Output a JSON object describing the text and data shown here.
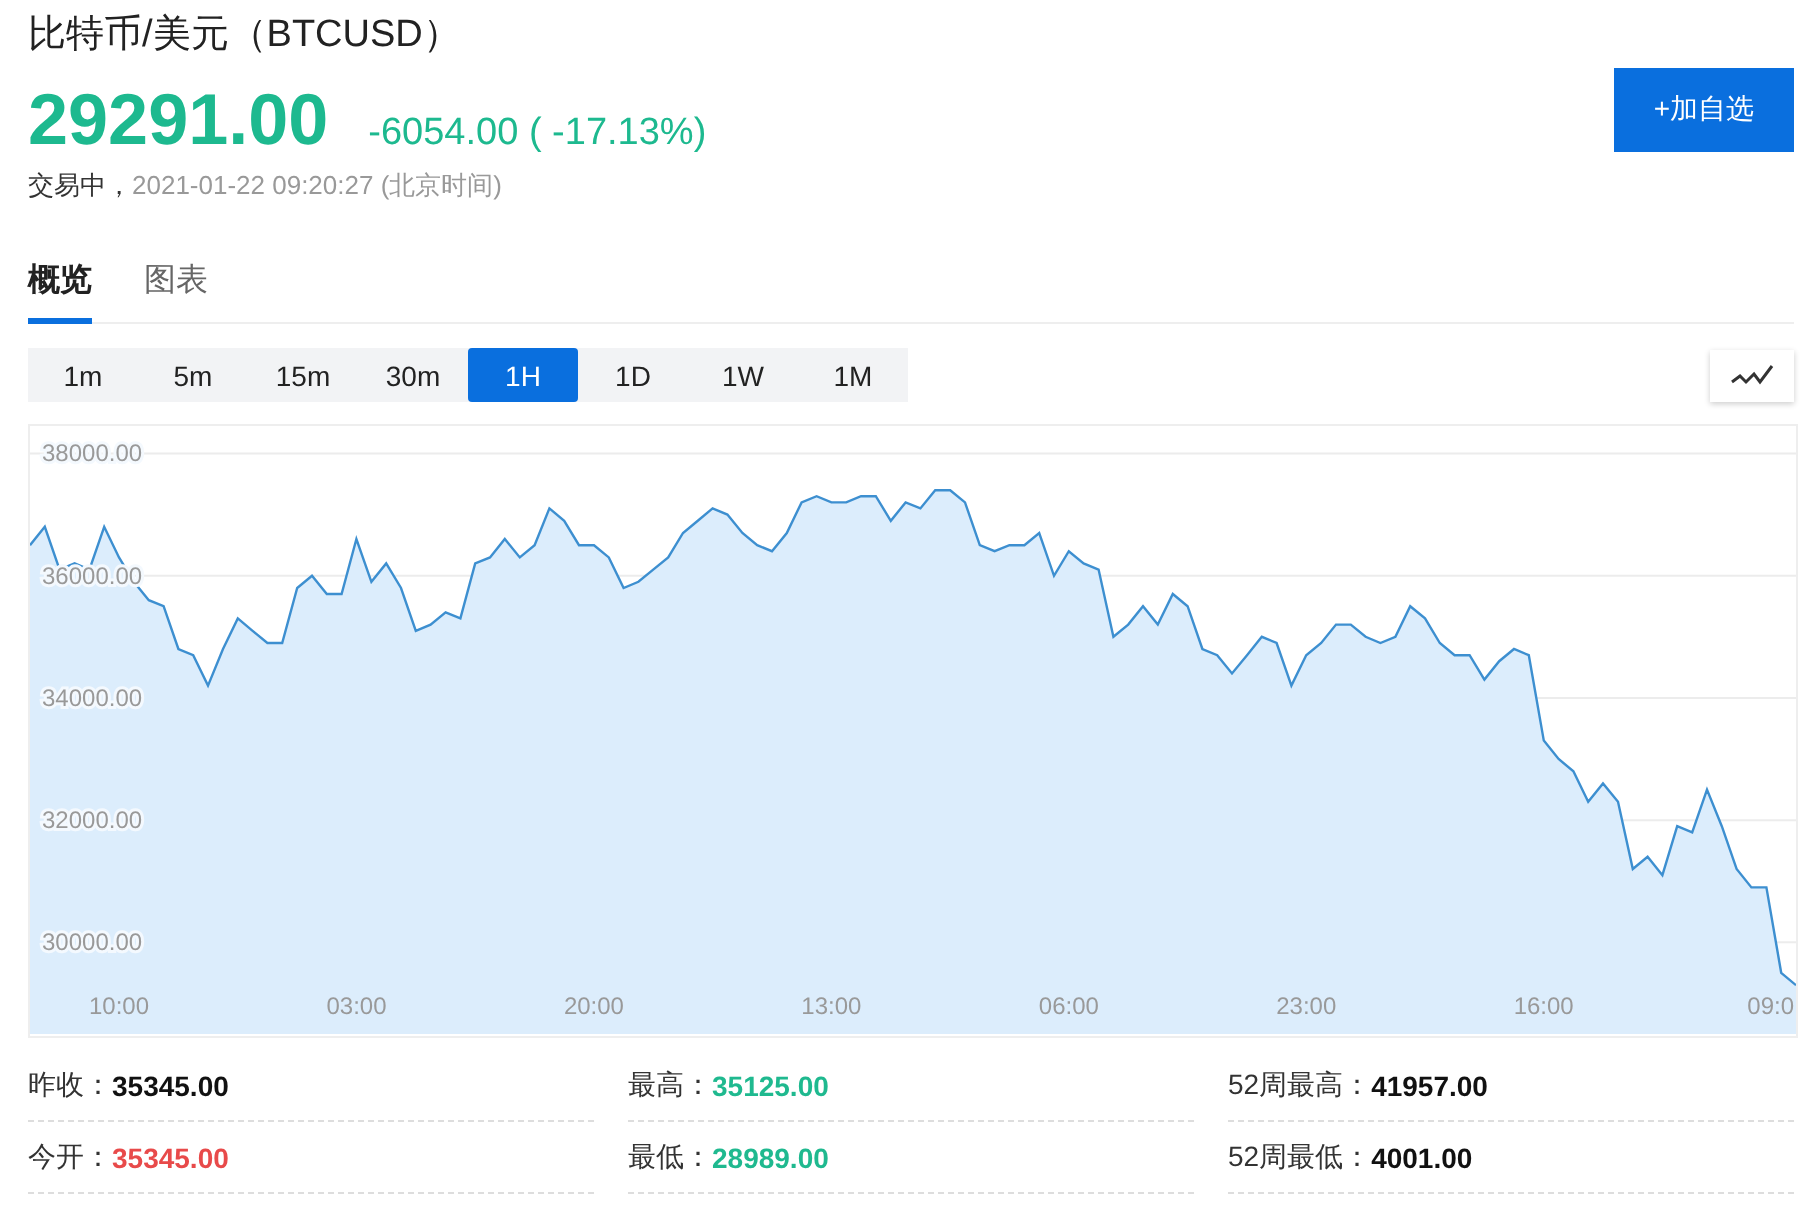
{
  "header": {
    "title": "比特币/美元（BTCUSD）",
    "price": "29291.00",
    "change": "-6054.00 ( -17.13%)",
    "status": "交易中，",
    "timestamp": "2021-01-22 09:20:27 (北京时间)",
    "watch_button": "+加自选"
  },
  "tabs": [
    {
      "label": "概览",
      "selected": true
    },
    {
      "label": "图表",
      "selected": false
    }
  ],
  "periods": [
    {
      "label": "1m",
      "selected": false
    },
    {
      "label": "5m",
      "selected": false
    },
    {
      "label": "15m",
      "selected": false
    },
    {
      "label": "30m",
      "selected": false
    },
    {
      "label": "1H",
      "selected": true
    },
    {
      "label": "1D",
      "selected": false
    },
    {
      "label": "1W",
      "selected": false
    },
    {
      "label": "1M",
      "selected": false
    }
  ],
  "chart": {
    "chart_data": {
      "type": "area",
      "grid": true,
      "ylim": [
        28500,
        38450
      ],
      "categories": [
        null,
        null,
        null,
        null,
        null,
        null,
        "10:00",
        null,
        null,
        null,
        null,
        null,
        null,
        null,
        null,
        null,
        null,
        null,
        null,
        null,
        null,
        null,
        "03:00",
        null,
        null,
        null,
        null,
        null,
        null,
        null,
        null,
        null,
        null,
        null,
        null,
        null,
        null,
        null,
        "20:00",
        null,
        null,
        null,
        null,
        null,
        null,
        null,
        null,
        null,
        null,
        null,
        null,
        null,
        null,
        null,
        "13:00",
        null,
        null,
        null,
        null,
        null,
        null,
        null,
        null,
        null,
        null,
        null,
        null,
        null,
        null,
        null,
        "06:00",
        null,
        null,
        null,
        null,
        null,
        null,
        null,
        null,
        null,
        null,
        null,
        null,
        null,
        null,
        null,
        "23:00",
        null,
        null,
        null,
        null,
        null,
        null,
        null,
        null,
        null,
        null,
        null,
        null,
        null,
        null,
        null,
        "16:00",
        null,
        null,
        null,
        null,
        null,
        null,
        null,
        null,
        null,
        null,
        null,
        null,
        null,
        null,
        "09:0",
        null,
        null
      ],
      "yticks": [
        {
          "value": 38000,
          "label": "38000.00"
        },
        {
          "value": 36000,
          "label": "36000.00"
        },
        {
          "value": 34000,
          "label": "34000.00"
        },
        {
          "value": 32000,
          "label": "32000.00"
        },
        {
          "value": 30000,
          "label": "30000.00"
        }
      ],
      "series": [
        {
          "color": "#3d8fd0",
          "values": [
            36500,
            36800,
            36100,
            36200,
            36100,
            36800,
            36300,
            35900,
            35600,
            35500,
            34800,
            34700,
            34200,
            34800,
            35300,
            35100,
            34900,
            34900,
            35800,
            36000,
            35700,
            35700,
            36600,
            35900,
            36200,
            35800,
            35100,
            35200,
            35400,
            35300,
            36200,
            36300,
            36600,
            36300,
            36500,
            37100,
            36900,
            36500,
            36500,
            36300,
            35800,
            35900,
            36100,
            36300,
            36700,
            36900,
            37100,
            37000,
            36700,
            36500,
            36400,
            36700,
            37200,
            37300,
            37200,
            37200,
            37300,
            37300,
            36900,
            37200,
            37100,
            37400,
            37400,
            37200,
            36500,
            36400,
            36500,
            36500,
            36700,
            36000,
            36400,
            36200,
            36100,
            35000,
            35200,
            35500,
            35200,
            35700,
            35500,
            34800,
            34700,
            34400,
            34700,
            35000,
            34900,
            34200,
            34700,
            34900,
            35200,
            35200,
            35000,
            34900,
            35000,
            35500,
            35300,
            34900,
            34700,
            34700,
            34300,
            34600,
            34800,
            34700,
            33300,
            33000,
            32800,
            32300,
            32600,
            32300,
            31200,
            31400,
            31100,
            31900,
            31800,
            32500,
            31900,
            31200,
            30900,
            30900,
            29500,
            29300
          ]
        }
      ]
    }
  },
  "stats": [
    {
      "label": "昨收：",
      "value": "35345.00",
      "color": "#111111"
    },
    {
      "label": "最高：",
      "value": "35125.00",
      "color": "#1fb98f"
    },
    {
      "label": "52周最高：",
      "value": "41957.00",
      "color": "#111111"
    },
    {
      "label": "今开：",
      "value": "35345.00",
      "color": "#e84a4a"
    },
    {
      "label": "最低：",
      "value": "28989.00",
      "color": "#1fb98f"
    },
    {
      "label": "52周最低：",
      "value": "4001.00",
      "color": "#111111"
    }
  ]
}
